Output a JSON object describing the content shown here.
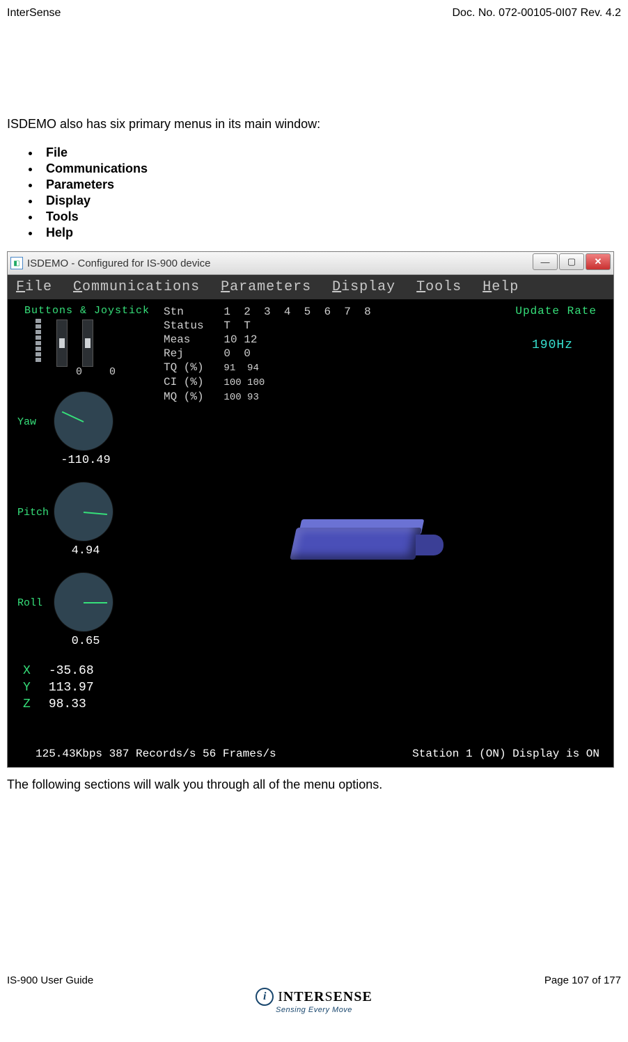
{
  "doc": {
    "vendor": "InterSense",
    "docno": "Doc. No. 072-00105-0I07 Rev. 4.2",
    "intro": "ISDEMO also has six primary menus in its main window:",
    "menus": [
      "File",
      "Communications",
      "Parameters",
      "Display",
      "Tools",
      "Help"
    ],
    "after": "The following sections will walk you through all of the menu options.",
    "footer_left": "IS-900 User Guide",
    "footer_right": "Page 107 of 177",
    "logo_name_pre": "I",
    "logo_name_main": "NTER",
    "logo_name_post": "S",
    "logo_name_end": "ENSE",
    "tagline": "Sensing Every Move"
  },
  "app": {
    "title": "ISDEMO - Configured for IS-900 device",
    "menubar": [
      "File",
      "Communications",
      "Parameters",
      "Display",
      "Tools",
      "Help"
    ],
    "bj_label": "Buttons & Joystick",
    "bj_vals": [
      "0",
      "0"
    ],
    "table": {
      "rows": [
        "Stn",
        "Status",
        "Meas",
        "Rej",
        "TQ (%)",
        "CI (%)",
        "MQ (%)"
      ],
      "cols_header": [
        "1",
        "2",
        "3",
        "4",
        "5",
        "6",
        "7",
        "8"
      ],
      "col1": [
        "",
        "T",
        "10",
        "0",
        "91",
        "100",
        "100"
      ],
      "col2": [
        "",
        "T",
        "12",
        "0",
        "94",
        "100",
        "93"
      ]
    },
    "update_rate_label": "Update Rate",
    "update_rate_value": "190Hz",
    "gauges": {
      "yaw": {
        "label": "Yaw",
        "value": "-110.49",
        "angle": -155
      },
      "pitch": {
        "label": "Pitch",
        "value": "4.94",
        "angle": 5
      },
      "roll": {
        "label": "Roll",
        "value": "0.65",
        "angle": 0
      }
    },
    "xyz": {
      "X": "-35.68",
      "Y": "113.97",
      "Z": "98.33"
    },
    "status_left": "125.43Kbps  387 Records/s   56 Frames/s",
    "status_right": "Station 1 (ON) Display is ON"
  }
}
